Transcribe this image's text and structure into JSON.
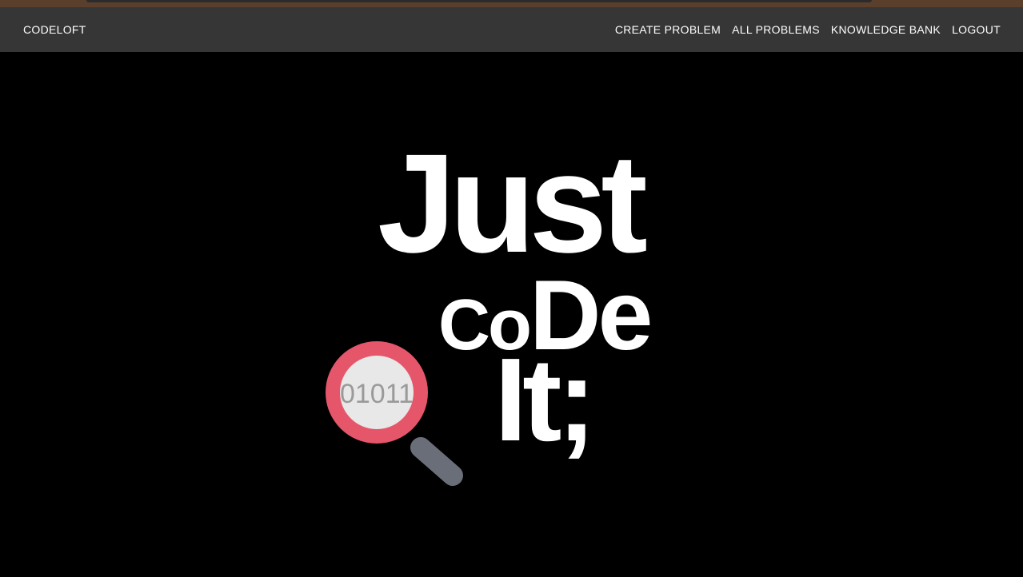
{
  "navbar": {
    "brand": "CODELOFT",
    "links": [
      {
        "label": "CREATE PROBLEM"
      },
      {
        "label": "ALL PROBLEMS"
      },
      {
        "label": "KNOWLEDGE BANK"
      },
      {
        "label": "LOGOUT"
      }
    ],
    "background": "#363636"
  },
  "hero": {
    "background": "#000000",
    "logo": {
      "line1": "Just",
      "line2_small": "Co",
      "line2_large": "De",
      "line3": "It;",
      "magnifier_text": "01011",
      "magnifier_ring_color": "#e5566a",
      "magnifier_handle_color": "#6a6e78"
    }
  }
}
